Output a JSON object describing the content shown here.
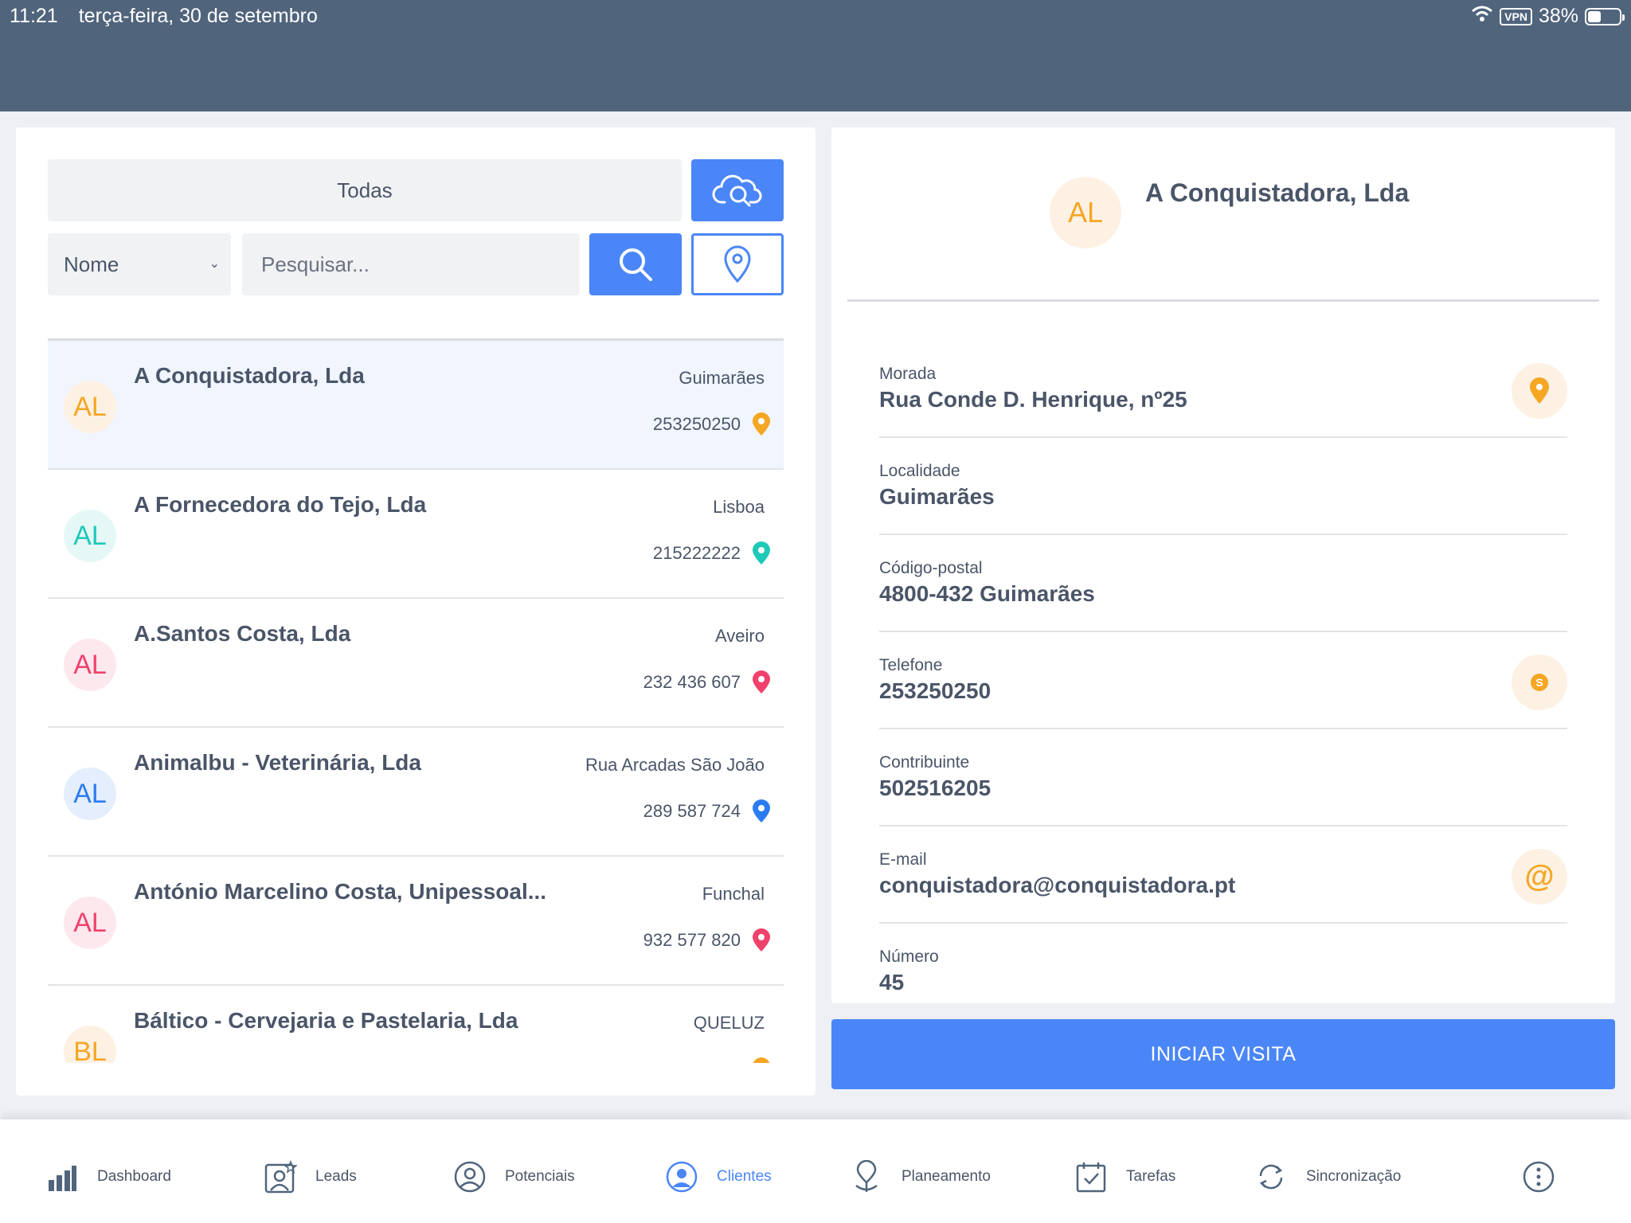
{
  "status_bar": {
    "time": "11:21",
    "date": "terça-feira, 30 de setembro",
    "vpn": "VPN",
    "battery": "38%",
    "battery_level": 0.38
  },
  "filters": {
    "category": "Todas",
    "field_select": "Nome",
    "search_placeholder": "Pesquisar..."
  },
  "clients": [
    {
      "initials": "AL",
      "name": "A Conquistadora, Lda",
      "city": "Guimarães",
      "phone": "253250250",
      "color": "#f5a623",
      "bg": "#fdf1e3"
    },
    {
      "initials": "AL",
      "name": "A Fornecedora do Tejo, Lda",
      "city": "Lisboa",
      "phone": "215222222",
      "color": "#1ec9b7",
      "bg": "#e5f8f6"
    },
    {
      "initials": "AL",
      "name": "A.Santos Costa, Lda",
      "city": "Aveiro",
      "phone": "232 436 607",
      "color": "#f0416c",
      "bg": "#fde8ee"
    },
    {
      "initials": "AL",
      "name": "Animalbu - Veterinária, Lda",
      "city": "Rua Arcadas São João",
      "phone": "289 587 724",
      "color": "#2b7cf0",
      "bg": "#e4eefc"
    },
    {
      "initials": "AL",
      "name": "António Marcelino Costa, Unipessoal...",
      "city": "Funchal",
      "phone": "932 577 820",
      "color": "#f0416c",
      "bg": "#fde8ee"
    },
    {
      "initials": "BL",
      "name": "Báltico -  Cervejaria e Pastelaria, Lda",
      "city": "QUELUZ",
      "phone": "",
      "color": "#f5a623",
      "bg": "#fdf1e3"
    }
  ],
  "detail": {
    "initials": "AL",
    "title": "A Conquistadora, Lda",
    "fields": [
      {
        "label": "Morada",
        "value": "Rua Conde D. Henrique, nº25",
        "action": "map-pin-icon"
      },
      {
        "label": "Localidade",
        "value": "Guimarães",
        "action": ""
      },
      {
        "label": "Código-postal",
        "value": "4800-432 Guimarães",
        "action": ""
      },
      {
        "label": "Telefone",
        "value": "253250250",
        "action": "skype-icon"
      },
      {
        "label": "Contribuinte",
        "value": "502516205",
        "action": ""
      },
      {
        "label": "E-mail",
        "value": "conquistadora@conquistadora.pt",
        "action": "at-sign-icon"
      },
      {
        "label": "Número",
        "value": "45",
        "action": ""
      }
    ],
    "start_visit": "INICIAR VISITA"
  },
  "nav": [
    {
      "label": "Dashboard",
      "icon": "bar-chart-icon",
      "active": false
    },
    {
      "label": "Leads",
      "icon": "leads-icon",
      "active": false
    },
    {
      "label": "Potenciais",
      "icon": "user-circle-icon",
      "active": false
    },
    {
      "label": "Clientes",
      "icon": "user-circle-filled-icon",
      "active": true
    },
    {
      "label": "Planeamento",
      "icon": "map-route-icon",
      "active": false
    },
    {
      "label": "Tarefas",
      "icon": "calendar-check-icon",
      "active": false
    },
    {
      "label": "Sincronização",
      "icon": "sync-icon",
      "active": false
    },
    {
      "label": "",
      "icon": "more-vertical-icon",
      "active": false
    }
  ],
  "colors": {
    "header": "#50647c",
    "accent": "#4a86f7",
    "selected_row": "#f0f5fe",
    "orange": "#f5a623"
  }
}
